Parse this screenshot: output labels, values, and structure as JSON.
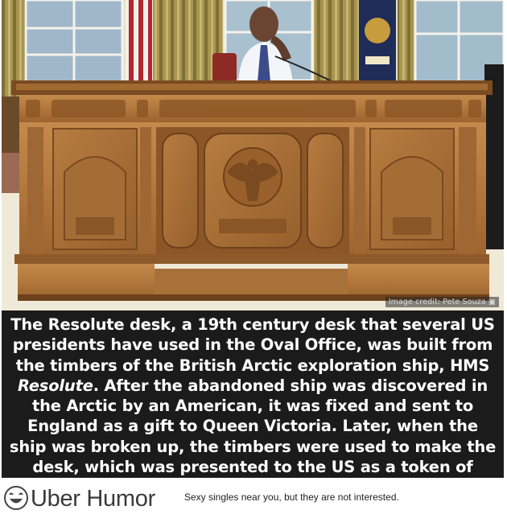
{
  "photo": {
    "credit": "Image credit: Pete Souza",
    "camera_icon": "camera-icon"
  },
  "caption": {
    "part1": "The Resolute desk, a 19th century desk that several US presidents have used in the Oval Office, was built from the timbers of the British Arctic exploration ship, HMS ",
    "ship_name": "Resolute",
    "part2": ". After the abandoned ship was discovered in the Arctic by an American, it was fixed and sent to England as a gift to Queen Victoria. Later, when the ship was broken up, the timbers were used to make the desk, which was presented to the US as a token of friendship and goodwill."
  },
  "footer": {
    "brand": "Uber Humor",
    "tagline": "Sexy singles near you, but they are not interested.",
    "logo_icon": "laughing-face-icon"
  },
  "colors": {
    "caption_background": "#1b1b1b",
    "caption_text": "#ffffff",
    "desk_wood": "#b47a3e",
    "brand_text": "#3a3a3a"
  }
}
